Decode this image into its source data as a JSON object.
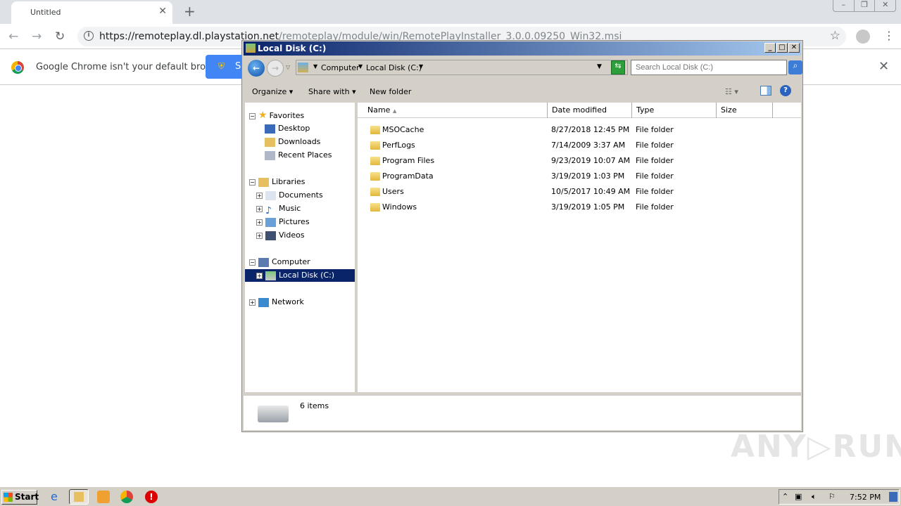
{
  "browser": {
    "tab_title": "Untitled",
    "url_host": "https://remoteplay.dl.playstation.net",
    "url_path": "/remoteplay/module/win/RemotePlayInstaller_3.0.0.09250_Win32.msi",
    "infobar_text": "Google Chrome isn't your default browser",
    "infobar_button": "S"
  },
  "explorer": {
    "title": "Local Disk (C:)",
    "breadcrumb": [
      "Computer",
      "Local Disk (C:)"
    ],
    "search_placeholder": "Search Local Disk (C:)",
    "commands": {
      "organize": "Organize",
      "share": "Share with",
      "new_folder": "New folder"
    },
    "nav": {
      "favorites": "Favorites",
      "desktop": "Desktop",
      "downloads": "Downloads",
      "recent": "Recent Places",
      "libraries": "Libraries",
      "documents": "Documents",
      "music": "Music",
      "pictures": "Pictures",
      "videos": "Videos",
      "computer": "Computer",
      "local_disk": "Local Disk (C:)",
      "network": "Network"
    },
    "columns": [
      "Name",
      "Date modified",
      "Type",
      "Size"
    ],
    "files": [
      {
        "name": "MSOCache",
        "date": "8/27/2018 12:45 PM",
        "type": "File folder"
      },
      {
        "name": "PerfLogs",
        "date": "7/14/2009 3:37 AM",
        "type": "File folder"
      },
      {
        "name": "Program Files",
        "date": "9/23/2019 10:07 AM",
        "type": "File folder"
      },
      {
        "name": "ProgramData",
        "date": "3/19/2019 1:03 PM",
        "type": "File folder"
      },
      {
        "name": "Users",
        "date": "10/5/2017 10:49 AM",
        "type": "File folder"
      },
      {
        "name": "Windows",
        "date": "3/19/2019 1:05 PM",
        "type": "File folder"
      }
    ],
    "status": "6 items"
  },
  "taskbar": {
    "start": "Start",
    "clock": "7:52 PM"
  },
  "watermark": "ANY RUN"
}
